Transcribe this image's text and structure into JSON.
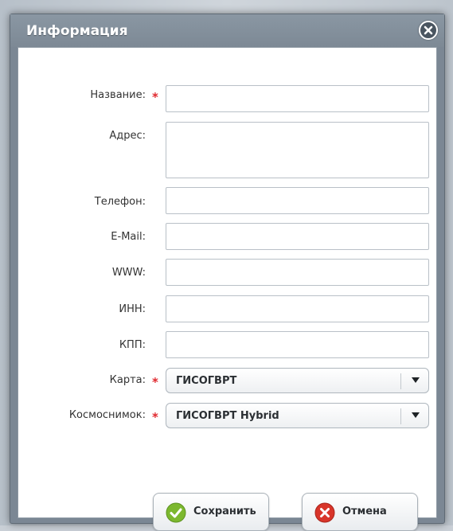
{
  "dialog": {
    "title": "Информация",
    "close_icon": "close-icon"
  },
  "form": {
    "name": {
      "label": "Название:",
      "required_mark": "*",
      "value": ""
    },
    "address": {
      "label": "Адрес:",
      "value": ""
    },
    "phone": {
      "label": "Телефон:",
      "value": ""
    },
    "email": {
      "label": "E-Mail:",
      "value": ""
    },
    "www": {
      "label": "WWW:",
      "value": ""
    },
    "inn": {
      "label": "ИНН:",
      "value": ""
    },
    "kpp": {
      "label": "КПП:",
      "value": ""
    },
    "map": {
      "label": "Карта:",
      "required_mark": "*",
      "selected": "ГИСОГВРТ"
    },
    "satellite": {
      "label": "Космоснимок:",
      "required_mark": "*",
      "selected": "ГИСОГВРТ Hybrid"
    }
  },
  "buttons": {
    "save_label": "Сохранить",
    "cancel_label": "Отмена"
  },
  "colors": {
    "required": "#e0282e",
    "save_icon": "#7cb82f",
    "cancel_icon": "#d8352a",
    "titlebar": "#7d8995"
  }
}
